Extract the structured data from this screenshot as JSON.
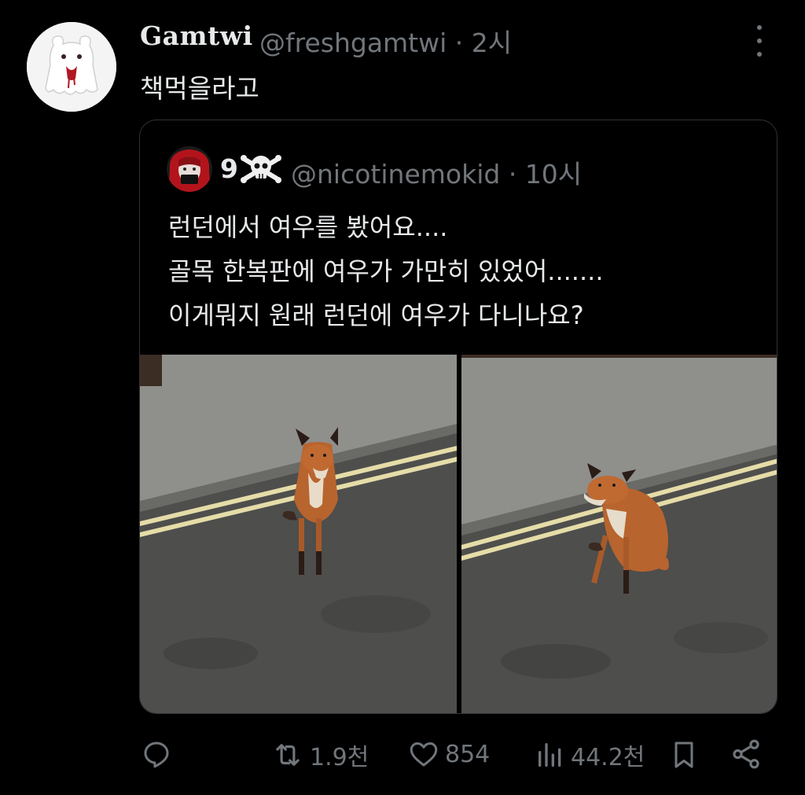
{
  "tweet": {
    "display_name": "Gamtwi",
    "handle": "@freshgamtwi",
    "separator": "·",
    "time": "2시",
    "text": "책먹을라고",
    "avatar_icon": "ghost-bear-avatar",
    "more_icon": "more-vertical-icon"
  },
  "quoted": {
    "display_name": "9",
    "name_emoji": "skull-crossbones-emoji",
    "handle": "@nicotinemokid",
    "separator": "·",
    "time": "10시",
    "lines": [
      "런던에서 여우를 봤어요....",
      "골목 한복판에 여우가 가만히 있었어.......",
      "이게뭐지 원래 런던에 여우가 다니나요?"
    ],
    "photos": [
      "fox-photo-1",
      "fox-photo-2"
    ]
  },
  "actions": {
    "reply": {
      "icon": "reply-icon",
      "label": ""
    },
    "retweet": {
      "icon": "retweet-icon",
      "label": "1.9천"
    },
    "like": {
      "icon": "heart-icon",
      "label": "854"
    },
    "views": {
      "icon": "views-icon",
      "label": "44.2천"
    },
    "bookmark": {
      "icon": "bookmark-icon"
    },
    "share": {
      "icon": "share-icon"
    }
  },
  "colors": {
    "background": "#000000",
    "text": "#e7e9ea",
    "muted": "#71767b",
    "border": "#2f3336"
  }
}
